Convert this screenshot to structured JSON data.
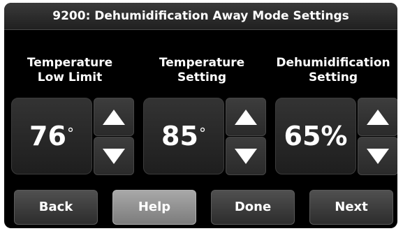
{
  "header": {
    "title": "9200: Dehumidification Away Mode Settings"
  },
  "controls": [
    {
      "label_line1": "Temperature",
      "label_line2": "Low Limit",
      "value": "76",
      "unit": "°"
    },
    {
      "label_line1": "Temperature",
      "label_line2": "Setting",
      "value": "85",
      "unit": "°"
    },
    {
      "label_line1": "Dehumidification",
      "label_line2": "Setting",
      "value": "65%",
      "unit": ""
    }
  ],
  "icons": {
    "increase": "up-arrow-icon",
    "decrease": "down-arrow-icon"
  },
  "buttons": {
    "back": "Back",
    "help": "Help",
    "done": "Done",
    "next": "Next"
  },
  "colors": {
    "background": "#000000",
    "text": "#ffffff",
    "help_button": "#9a9a9a"
  }
}
